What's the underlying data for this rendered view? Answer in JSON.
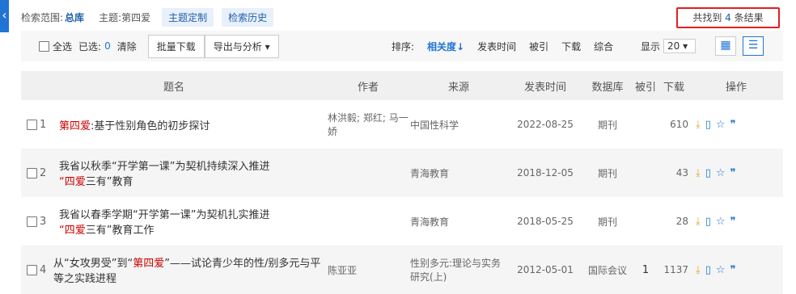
{
  "topbar": {
    "scope_label": "检索范围:",
    "scope_value": "总库",
    "subject_label": "主题:",
    "subject_value": "第四爱",
    "custom_btn": "主题定制",
    "history_btn": "检索历史",
    "result_prefix": "共找到 ",
    "result_count": "4",
    "result_suffix": " 条结果"
  },
  "toolbar": {
    "select_all": "全选",
    "selected_label": "已选:",
    "selected_count": "0",
    "clear": "清除",
    "batch_download": "批量下载",
    "export": "导出与分析",
    "sort_label": "排序:",
    "sort_relevance": "相关度",
    "sort_date": "发表时间",
    "sort_cited": "被引",
    "sort_download": "下载",
    "sort_combined": "综合",
    "show_label": "显示",
    "page_size": "20"
  },
  "table": {
    "headers": [
      "题名",
      "作者",
      "来源",
      "发表时间",
      "数据库",
      "被引",
      "下载",
      "操作"
    ],
    "rows": [
      {
        "idx": "1",
        "title_hl": "第四爱",
        "title_rest": ":基于性别角色的初步探讨",
        "author": "林洪毅; 郑红; 马一娇",
        "source": "中国性科学",
        "date": "2022-08-25",
        "db": "期刊",
        "cited": "",
        "downloads": "610"
      },
      {
        "idx": "2",
        "title_pre": "我省以秋季“开学第一课”为契机持续深入推进",
        "title_hl": "“四爱",
        "title_rest": "三有”教育",
        "author": "",
        "source": "青海教育",
        "date": "2018-12-05",
        "db": "期刊",
        "cited": "",
        "downloads": "43"
      },
      {
        "idx": "3",
        "title_pre": "我省以春季学期“开学第一课”为契机扎实推进",
        "title_hl": "“四爱",
        "title_rest": "三有”教育工作",
        "author": "",
        "source": "青海教育",
        "date": "2018-05-25",
        "db": "期刊",
        "cited": "",
        "downloads": "28"
      },
      {
        "idx": "4",
        "title_pre": "从“女攻男受”到“",
        "title_hl": "第四爱",
        "title_rest": "”——试论青少年的性/别多元与平等之实践进程",
        "author": "陈亚亚",
        "source": "性别多元:理论与实务研究(上)",
        "date": "2012-05-01",
        "db": "国际会议",
        "cited": "1",
        "downloads": "1137"
      }
    ]
  }
}
